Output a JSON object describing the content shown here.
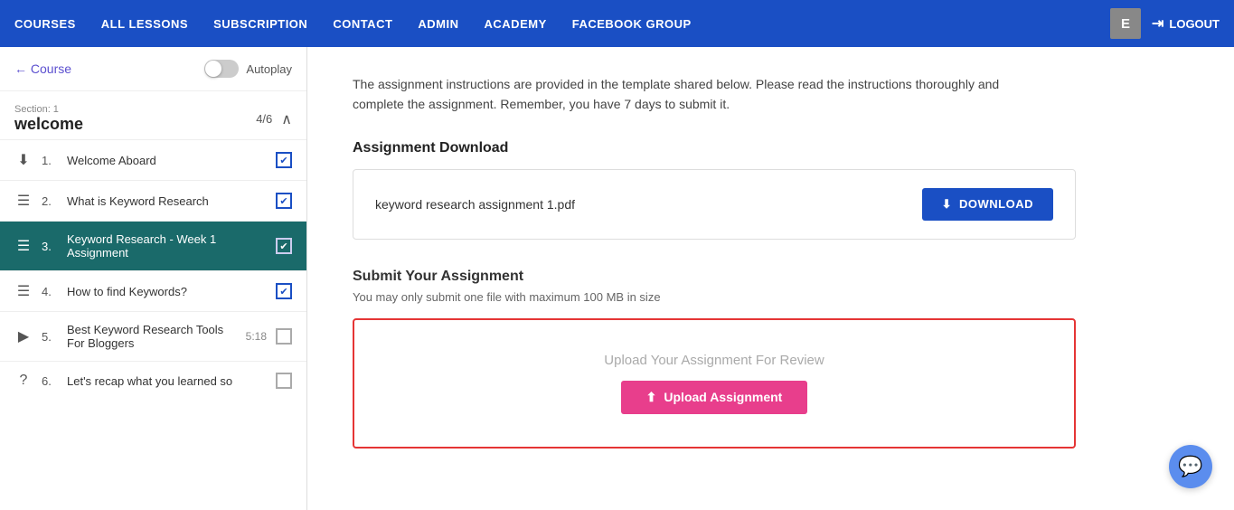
{
  "nav": {
    "items": [
      {
        "label": "COURSES",
        "id": "courses"
      },
      {
        "label": "ALL LESSONS",
        "id": "all-lessons"
      },
      {
        "label": "SUBSCRIPTION",
        "id": "subscription"
      },
      {
        "label": "CONTACT",
        "id": "contact"
      },
      {
        "label": "ADMIN",
        "id": "admin"
      },
      {
        "label": "ACADEMY",
        "id": "academy"
      },
      {
        "label": "FACEBOOK GROUP",
        "id": "facebook-group"
      }
    ],
    "avatar_letter": "E",
    "logout_label": "LOGOUT"
  },
  "sidebar": {
    "back_label": "← Course",
    "autoplay_label": "Autoplay",
    "section_label": "Section: 1",
    "section_title": "welcome",
    "section_count": "4/6",
    "lessons": [
      {
        "num": "1.",
        "icon": "⬇",
        "title": "Welcome Aboard",
        "meta": "",
        "checked": true,
        "active": false
      },
      {
        "num": "2.",
        "icon": "☰",
        "title": "What is Keyword Research",
        "meta": "",
        "checked": true,
        "active": false
      },
      {
        "num": "3.",
        "icon": "☰",
        "title": "Keyword Research - Week 1 Assignment",
        "meta": "",
        "checked": true,
        "active": true
      },
      {
        "num": "4.",
        "icon": "☰",
        "title": "How to find Keywords?",
        "meta": "",
        "checked": true,
        "active": false
      },
      {
        "num": "5.",
        "icon": "▶",
        "title": "Best Keyword Research Tools For Bloggers",
        "meta": "5:18",
        "checked": false,
        "active": false
      },
      {
        "num": "6.",
        "icon": "?",
        "title": "Let's recap what you learned so",
        "meta": "",
        "checked": false,
        "active": false
      }
    ]
  },
  "content": {
    "instruction": "The assignment instructions are provided in the template shared below. Please read the instructions thoroughly and complete the assignment. Remember, you have 7 days to submit it.",
    "download_heading": "Assignment Download",
    "download_filename": "keyword research assignment 1.pdf",
    "download_btn": "DOWNLOAD",
    "submit_heading": "Submit Your Assignment",
    "submit_subtext": "You may only submit one file with maximum 100 MB in size",
    "upload_prompt": "Upload Your Assignment For Review",
    "upload_btn": "Upload Assignment"
  },
  "icons": {
    "arrow_left": "←",
    "download": "⬇",
    "upload": "⬆",
    "chat": "💬",
    "checkmark": "✔"
  }
}
